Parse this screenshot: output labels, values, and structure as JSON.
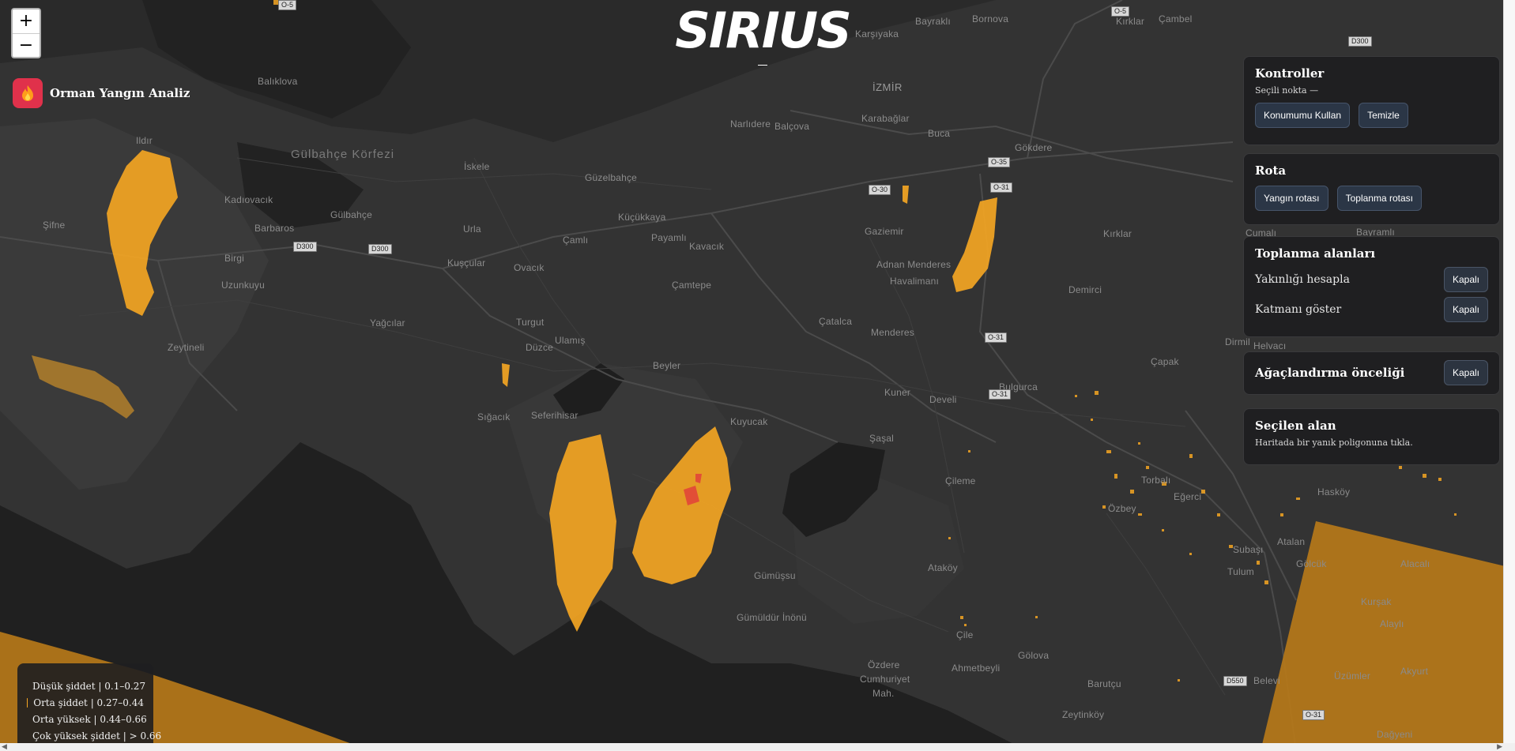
{
  "app": {
    "logo_text": "SIRIUS",
    "brand_title": "Orman Yangın Analiz"
  },
  "zoom": {
    "in_label": "+",
    "out_label": "−"
  },
  "panels": {
    "controls": {
      "title": "Kontroller",
      "selected_point": "Seçili nokta —",
      "use_location_label": "Konumumu Kullan",
      "clear_label": "Temizle"
    },
    "route": {
      "title": "Rota",
      "fire_route_label": "Yangın rotası",
      "assembly_route_label": "Toplanma rotası"
    },
    "assembly_areas": {
      "title": "Toplanma alanları",
      "proximity_label": "Yakınlığı hesapla",
      "proximity_state": "Kapalı",
      "layer_label": "Katmanı göster",
      "layer_state": "Kapalı"
    },
    "afforestation": {
      "title": "Ağaçlandırma önceliği",
      "state": "Kapalı"
    },
    "selected_area": {
      "title": "Seçilen alan",
      "hint": "Haritada bir yanık poligonuna tıkla."
    }
  },
  "legend": {
    "items": [
      {
        "label": "Düşük şiddet | 0.1–0.27",
        "color": "#22c55e"
      },
      {
        "label": "Orta şiddet | 0.27–0.44",
        "color": "#f5a623"
      },
      {
        "label": "Orta yüksek | 0.44–0.66",
        "color": "#ef4444"
      },
      {
        "label": "Çok yüksek şiddet | > 0.66",
        "color": "#b91c1c"
      }
    ]
  },
  "map": {
    "water_label": "Gülbahçe Körfezi",
    "place_labels": [
      "Bayraklı",
      "Bornova",
      "Karşıyaka",
      "Çambel",
      "İZMİR",
      "Balıklova",
      "Narlıdere",
      "Balçova",
      "Karabağlar",
      "Buca",
      "Gökdere",
      "Ildır",
      "İskele",
      "Güzelbahçe",
      "Kadıovacık",
      "Gülbahçe",
      "Şifne",
      "Barbaros",
      "Urla",
      "Küçükkaya",
      "Payamlı",
      "Gaziemir",
      "Kırklar",
      "Birgi",
      "Çamlı",
      "Kavacık",
      "Adnan Menderes Havalimanı",
      "Uzunkuyu",
      "Kuşçular",
      "Ovacık",
      "Çamtepe",
      "Demirci",
      "Yağcılar",
      "Turgut",
      "Çatalca",
      "Menderes",
      "Zeytineli",
      "Düzce",
      "Ulamış",
      "Dirmil",
      "Beyler",
      "Çapak",
      "Bulgurca",
      "Kuner",
      "Develi",
      "Sığacık",
      "Seferihisar",
      "Kuyucak",
      "Şaşal",
      "Torbalı",
      "Özbey",
      "Eğerci",
      "Hasköy",
      "Çileme",
      "Subaşı",
      "Atalan",
      "Gölcük",
      "Alacalı",
      "Kurşak",
      "Tulum",
      "Alaylı",
      "Gümüşsu",
      "Ataköy",
      "Gümüldür İnönü",
      "Çile",
      "Akyurt",
      "Üzümler",
      "Özdere",
      "Ahmetbeyli",
      "Gölova",
      "Cumhuriyet Mah.",
      "Barutçu",
      "Belevi",
      "Zeytinköy",
      "Dağyeni"
    ],
    "road_labels": [
      "O-5",
      "D300",
      "O-35",
      "O-30",
      "O-31",
      "D550"
    ],
    "fire_colors": {
      "medium": "#f5a623",
      "high": "#e23b3b"
    }
  }
}
